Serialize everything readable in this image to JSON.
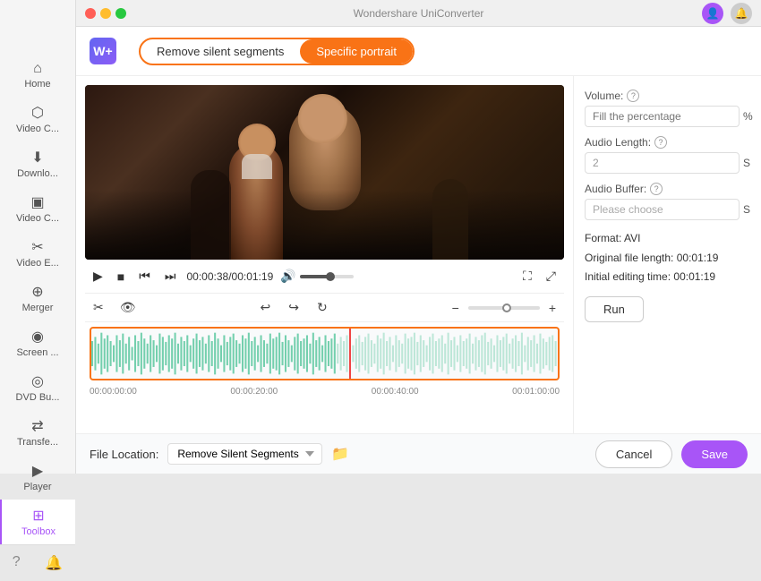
{
  "window": {
    "title": "Wondershare UniConverter",
    "traffic_lights": [
      "red",
      "yellow",
      "green"
    ]
  },
  "titlebar": {
    "title": "Wondershare UniConverter",
    "user_icon": "👤",
    "notif_icon": "🔔"
  },
  "app": {
    "logo_text": "W+"
  },
  "tabs": {
    "tab1": {
      "label": "Remove silent segments",
      "active": false
    },
    "tab2": {
      "label": "Specific portrait",
      "active": true
    }
  },
  "sidebar": {
    "items": [
      {
        "id": "home",
        "icon": "⌂",
        "label": "Home"
      },
      {
        "id": "video-converter",
        "icon": "⬡",
        "label": "Video C..."
      },
      {
        "id": "downloader",
        "icon": "⬇",
        "label": "Downlo..."
      },
      {
        "id": "video-compressor",
        "icon": "▣",
        "label": "Video C..."
      },
      {
        "id": "video-editor",
        "icon": "✂",
        "label": "Video E..."
      },
      {
        "id": "merger",
        "icon": "⊕",
        "label": "Merger"
      },
      {
        "id": "screen-recorder",
        "icon": "◉",
        "label": "Screen ..."
      },
      {
        "id": "dvd-burner",
        "icon": "◎",
        "label": "DVD Bu..."
      },
      {
        "id": "transfer",
        "icon": "⇄",
        "label": "Transfe..."
      },
      {
        "id": "player",
        "icon": "▶",
        "label": "Player"
      },
      {
        "id": "toolbox",
        "icon": "⊞",
        "label": "Toolbox",
        "active": true
      }
    ],
    "bottom": [
      {
        "id": "help",
        "icon": "?"
      },
      {
        "id": "bell",
        "icon": "🔔"
      }
    ]
  },
  "controls": {
    "play_icon": "▶",
    "stop_icon": "■",
    "prev_icon": "⏮",
    "next_icon": "⏭",
    "time_current": "00:00:38",
    "time_total": "00:01:19",
    "volume_icon": "🔊",
    "fullscreen_icon": "⛶",
    "expand_icon": "⤢"
  },
  "edit_toolbar": {
    "cut_icon": "✂",
    "eye_icon": "👁",
    "undo_icon": "↩",
    "redo_forward": "↪",
    "redo2_icon": "↻",
    "zoom_in": "+",
    "zoom_out": "−"
  },
  "timeline": {
    "labels": [
      "00:00:00:00",
      "00:00:20:00",
      "00:00:40:00",
      "00:01:00:00"
    ]
  },
  "right_panel": {
    "volume_label": "Volume:",
    "volume_placeholder": "Fill the percentage",
    "volume_suffix": "%",
    "audio_length_label": "Audio Length:",
    "audio_length_value": "2",
    "audio_length_suffix": "S",
    "audio_buffer_label": "Audio Buffer:",
    "audio_buffer_placeholder": "Please choose",
    "audio_buffer_suffix": "S",
    "format_label": "Format:",
    "format_value": "AVI",
    "original_length_label": "Original file length:",
    "original_length_value": "00:01:19",
    "initial_time_label": "Initial editing time:",
    "initial_time_value": "00:01:19",
    "run_button": "Run"
  },
  "bottom_bar": {
    "file_location_label": "File Location:",
    "file_location_value": "Remove Silent Segments",
    "cancel_button": "Cancel",
    "save_button": "Save"
  }
}
